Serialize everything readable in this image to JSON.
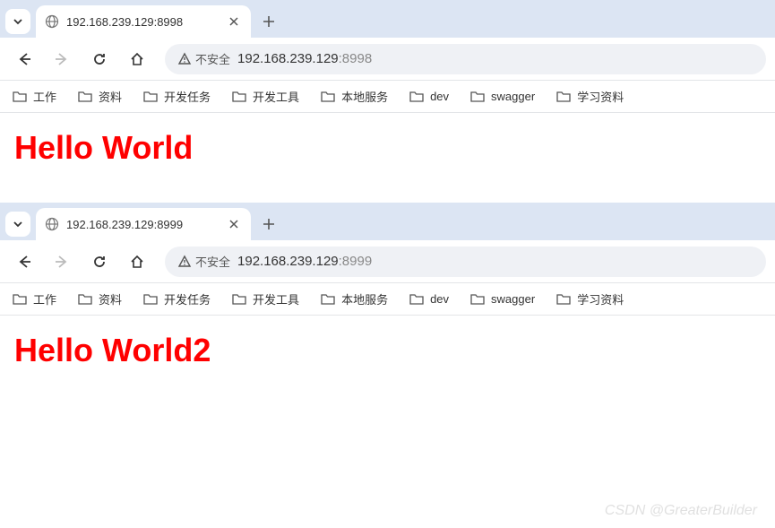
{
  "windows": [
    {
      "tab": {
        "title": "192.168.239.129:8998"
      },
      "address": {
        "security_label": "不安全",
        "url_host": "192.168.239.129",
        "url_port": ":8998"
      },
      "content_heading": "Hello World"
    },
    {
      "tab": {
        "title": "192.168.239.129:8999"
      },
      "address": {
        "security_label": "不安全",
        "url_host": "192.168.239.129",
        "url_port": ":8999"
      },
      "content_heading": "Hello World2"
    }
  ],
  "bookmarks": [
    {
      "label": "工作"
    },
    {
      "label": "资料"
    },
    {
      "label": "开发任务"
    },
    {
      "label": "开发工具"
    },
    {
      "label": "本地服务"
    },
    {
      "label": "dev"
    },
    {
      "label": "swagger"
    },
    {
      "label": "学习资料"
    }
  ],
  "watermark": "CSDN @GreaterBuilder"
}
